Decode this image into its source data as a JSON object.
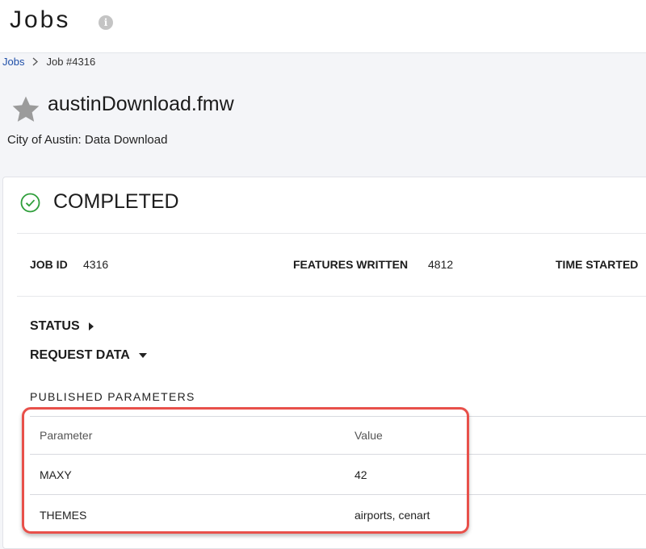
{
  "header": {
    "title": "Jobs",
    "info_icon": "info-icon"
  },
  "breadcrumb": {
    "parent": "Jobs",
    "current": "Job #4316"
  },
  "workspace": {
    "name": "austinDownload.fmw",
    "description": "City of Austin: Data Download",
    "favorite_icon": "star-icon"
  },
  "job": {
    "status": "COMPLETED",
    "status_color": "#2e9e3a",
    "summary": [
      {
        "label": "JOB ID",
        "value": "4316"
      },
      {
        "label": "FEATURES WRITTEN",
        "value": "4812"
      },
      {
        "label": "TIME STARTED",
        "value": ""
      }
    ]
  },
  "sections": {
    "status": "STATUS",
    "request_data": "REQUEST DATA"
  },
  "published_parameters": {
    "heading": "PUBLISHED PARAMETERS",
    "columns": [
      "Parameter",
      "Value"
    ],
    "rows": [
      {
        "parameter": "MAXY",
        "value": "42"
      },
      {
        "parameter": "THEMES",
        "value": "airports, cenart"
      }
    ]
  },
  "annotation": {
    "highlight_color": "#e8504a"
  }
}
